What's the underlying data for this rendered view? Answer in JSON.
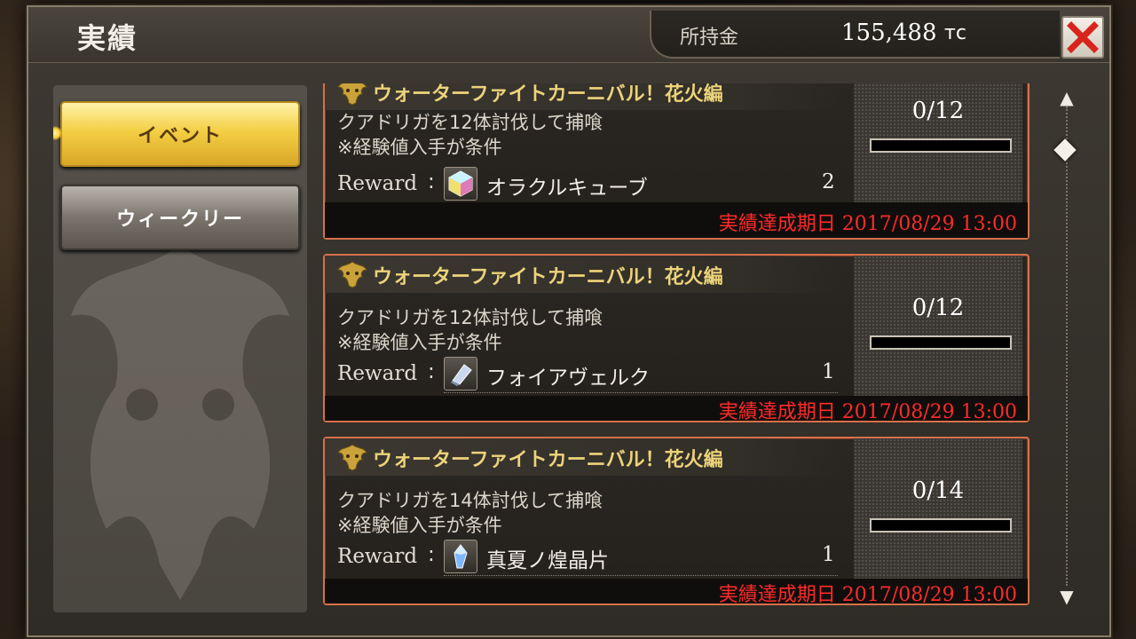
{
  "header": {
    "title": "実績",
    "money_label": "所持金",
    "money_value": "155,488",
    "money_unit": "тс"
  },
  "sidebar": {
    "tabs": [
      {
        "label": "イベント",
        "active": true
      },
      {
        "label": "ウィークリー",
        "active": false
      }
    ]
  },
  "achievements": [
    {
      "event_name": "ウォーターファイトカーニバル！花火編",
      "desc_line1": "クアドリガを12体討伐して捕喰",
      "desc_line2": "※経験値入手が条件",
      "reward_label": "Reward",
      "reward_colon": ":",
      "item_icon": "cube-icon",
      "item_name": "オラクルキューブ",
      "item_qty": "2",
      "progress_text": "0/12",
      "progress_fraction": 0,
      "deadline": "実績達成期日 2017/08/29 13:00"
    },
    {
      "event_name": "ウォーターファイトカーニバル！花火編",
      "desc_line1": "クアドリガを12体討伐して捕喰",
      "desc_line2": "※経験値入手が条件",
      "reward_label": "Reward",
      "reward_colon": ":",
      "item_icon": "material-icon",
      "item_name": "フォイアヴェルク",
      "item_qty": "1",
      "progress_text": "0/12",
      "progress_fraction": 0,
      "deadline": "実績達成期日 2017/08/29 13:00"
    },
    {
      "event_name": "ウォーターファイトカーニバル！花火編",
      "desc_line1": "クアドリガを14体討伐して捕喰",
      "desc_line2": "※経験値入手が条件",
      "reward_label": "Reward",
      "reward_colon": ":",
      "item_icon": "crystal-icon",
      "item_name": "真夏ノ煌晶片",
      "item_qty": "1",
      "progress_text": "0/14",
      "progress_fraction": 0,
      "deadline": "実績達成期日 2017/08/29 13:00"
    }
  ],
  "colors": {
    "accent_gold": "#ecd37a",
    "deadline_red": "#ff2a2a",
    "card_border": "#d8704a",
    "close_x": "#d8241c"
  }
}
